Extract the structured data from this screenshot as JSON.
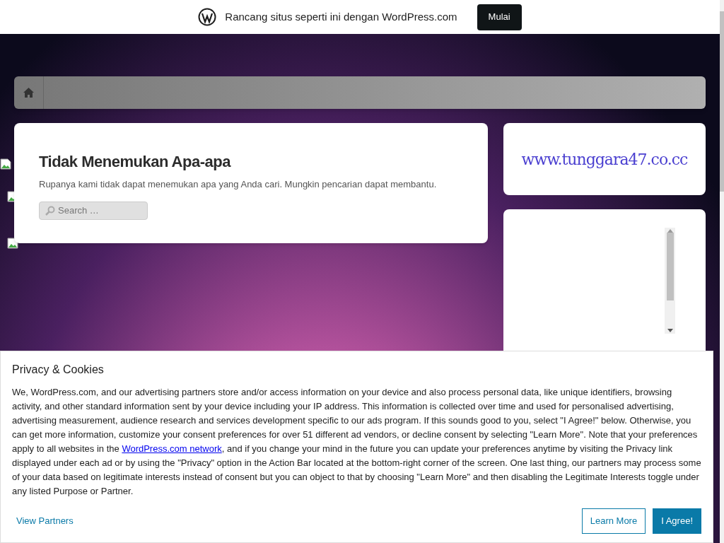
{
  "promo_bar": {
    "text": "Rancang situs seperti ini dengan WordPress.com",
    "button": "Mulai"
  },
  "main": {
    "title": "Tidak Menemukan Apa-apa",
    "message": "Rupanya kami tidak dapat menemukan apa yang Anda cari. Mungkin pencarian dapat membantu.",
    "search": {
      "placeholder": "Search …"
    }
  },
  "sidebar": {
    "logo_text": "www.tunggara47.co.cc"
  },
  "consent": {
    "title": "Privacy & Cookies",
    "text_before": "We, WordPress.com, and our advertising partners store and/or access information on your device and also process personal data, like unique identifiers, browsing activity, and other standard information sent by your device including your IP address. This information is collected over time and used for personalised advertising, advertising measurement, audience research and services development specific to our ads program. If this sounds good to you, select \"I Agree!\" below. Otherwise, you can get more information, customize your consent preferences for over 51 different ad vendors, or decline consent by selecting \"Learn More\". Note that your preferences apply to all websites in the ",
    "link": "WordPress.com network",
    "text_after": ", and if you change your mind in the future you can update your preferences anytime by visiting the Privacy link displayed under each ad or by using the \"Privacy\" option in the Action Bar located at the bottom-right corner of the screen. One last thing, our partners may process some of your data based on legitimate interests instead of consent but you can object to that by choosing \"Learn More\" and then disabling the Legitimate Interests toggle under any listed Purpose or Partner.",
    "view_partners": "View Partners",
    "learn_more": "Learn More",
    "agree": "I Agree!"
  }
}
